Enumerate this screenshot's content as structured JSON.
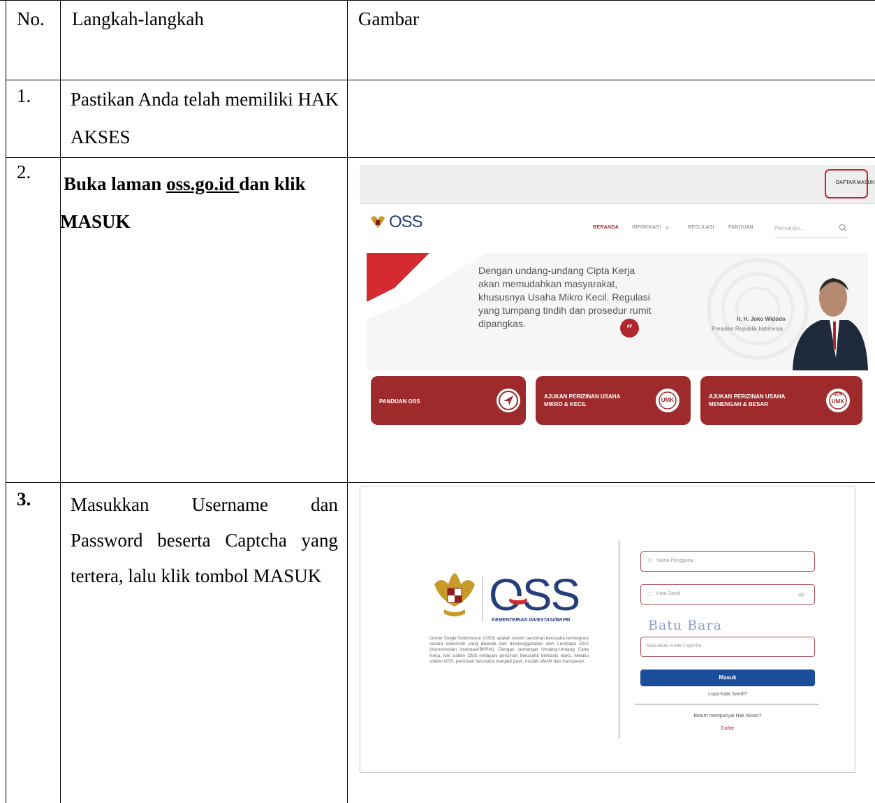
{
  "table": {
    "headers": {
      "no": "No.",
      "steps": "Langkah-langkah",
      "image": "Gambar"
    },
    "rows": [
      {
        "no": "1.",
        "text": "Pastikan Anda telah memiliki HAK AKSES"
      },
      {
        "no": "2.",
        "text_prefix": "Buka laman ",
        "link": "oss.go.id ",
        "text_suffix": "dan klik MASUK"
      },
      {
        "no": "3.",
        "text": "Masukkan Username dan Password beserta Captcha yang tertera, lalu klik tombol MASUK"
      }
    ]
  },
  "homepage": {
    "top_links": {
      "daftar": "DAFTAR",
      "separator": "|",
      "masuk": "MASUK"
    },
    "logo_text": "OSS",
    "nav": [
      "BERANDA",
      "INFORMASI",
      "REGULASI",
      "PANDUAN"
    ],
    "nav_dropdown_glyph": "∨",
    "search_placeholder": "Pencarian...",
    "hero_quote": "Dengan undang-undang Cipta Kerja akan memudahkan masyarakat, khususnya Usaha Mikro Kecil. Regulasi yang tumpang tindih dan prosedur rumit dipangkas.",
    "hero_name": "Ir. H. Joko Widodo",
    "hero_title": "Presiden Republik Indonesia",
    "quote_glyph": "“",
    "cards": [
      {
        "label": "PANDUAN OSS"
      },
      {
        "label": "AJUKAN PERIZINAN USAHA MIKRO & KECIL",
        "badge": "UMK"
      },
      {
        "label": "AJUKAN PERIZINAN USAHA MENENGAH & BESAR",
        "badge_top": "NON",
        "badge": "UMK"
      }
    ],
    "colors": {
      "brand_red": "#9e2a2b",
      "highlight": "#c0262b",
      "brand_blue": "#233e7a"
    }
  },
  "login": {
    "logo_text": "OSS",
    "ministry": "KEMENTERIAN INVESTASI/BKPM",
    "description": "Online Single Submission (OSS) adalah sistem perizinan berusaha terintegrasi secara elektronik yang dikelola dan diselenggarakan oleh Lembaga OSS (Kementerian Investasi/BKPM). Dengan semangat Undang-Undang Cipta Kerja, kini sistem OSS melayani perizinan berusaha berbasis risiko. Melalui sistem OSS, perizinan berusaha menjadi pasti, mudah efektif dan transparan.",
    "username_placeholder": "Nama Pengguna",
    "password_placeholder": "Kata Sandi",
    "captcha_text": "Batu Bara",
    "captcha_placeholder": "Masukkan Kode Captcha",
    "submit_label": "Masuk",
    "forgot_label": "Lupa Kata Sandi?",
    "no_access_label": "Belum mempunyai Hak Akses?",
    "register_label": "Daftar",
    "colors": {
      "button_blue": "#1b4d9a",
      "captcha": "#8d9ccf",
      "input_border": "#b54d56"
    }
  }
}
